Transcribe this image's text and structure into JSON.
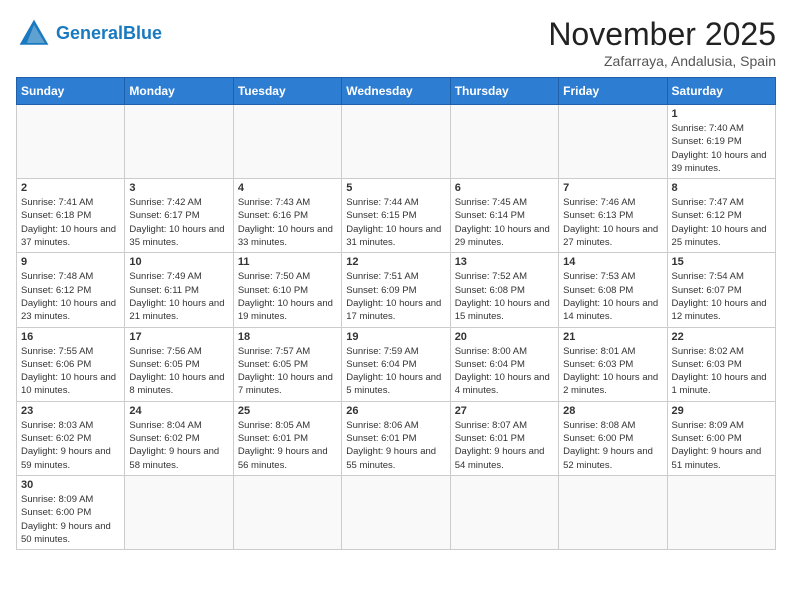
{
  "header": {
    "logo_general": "General",
    "logo_blue": "Blue",
    "month_title": "November 2025",
    "location": "Zafarraya, Andalusia, Spain"
  },
  "weekdays": [
    "Sunday",
    "Monday",
    "Tuesday",
    "Wednesday",
    "Thursday",
    "Friday",
    "Saturday"
  ],
  "days": [
    {
      "date": "",
      "info": ""
    },
    {
      "date": "",
      "info": ""
    },
    {
      "date": "",
      "info": ""
    },
    {
      "date": "",
      "info": ""
    },
    {
      "date": "",
      "info": ""
    },
    {
      "date": "",
      "info": ""
    },
    {
      "date": "1",
      "info": "Sunrise: 7:40 AM\nSunset: 6:19 PM\nDaylight: 10 hours\nand 39 minutes."
    },
    {
      "date": "2",
      "info": "Sunrise: 7:41 AM\nSunset: 6:18 PM\nDaylight: 10 hours\nand 37 minutes."
    },
    {
      "date": "3",
      "info": "Sunrise: 7:42 AM\nSunset: 6:17 PM\nDaylight: 10 hours\nand 35 minutes."
    },
    {
      "date": "4",
      "info": "Sunrise: 7:43 AM\nSunset: 6:16 PM\nDaylight: 10 hours\nand 33 minutes."
    },
    {
      "date": "5",
      "info": "Sunrise: 7:44 AM\nSunset: 6:15 PM\nDaylight: 10 hours\nand 31 minutes."
    },
    {
      "date": "6",
      "info": "Sunrise: 7:45 AM\nSunset: 6:14 PM\nDaylight: 10 hours\nand 29 minutes."
    },
    {
      "date": "7",
      "info": "Sunrise: 7:46 AM\nSunset: 6:13 PM\nDaylight: 10 hours\nand 27 minutes."
    },
    {
      "date": "8",
      "info": "Sunrise: 7:47 AM\nSunset: 6:12 PM\nDaylight: 10 hours\nand 25 minutes."
    },
    {
      "date": "9",
      "info": "Sunrise: 7:48 AM\nSunset: 6:12 PM\nDaylight: 10 hours\nand 23 minutes."
    },
    {
      "date": "10",
      "info": "Sunrise: 7:49 AM\nSunset: 6:11 PM\nDaylight: 10 hours\nand 21 minutes."
    },
    {
      "date": "11",
      "info": "Sunrise: 7:50 AM\nSunset: 6:10 PM\nDaylight: 10 hours\nand 19 minutes."
    },
    {
      "date": "12",
      "info": "Sunrise: 7:51 AM\nSunset: 6:09 PM\nDaylight: 10 hours\nand 17 minutes."
    },
    {
      "date": "13",
      "info": "Sunrise: 7:52 AM\nSunset: 6:08 PM\nDaylight: 10 hours\nand 15 minutes."
    },
    {
      "date": "14",
      "info": "Sunrise: 7:53 AM\nSunset: 6:08 PM\nDaylight: 10 hours\nand 14 minutes."
    },
    {
      "date": "15",
      "info": "Sunrise: 7:54 AM\nSunset: 6:07 PM\nDaylight: 10 hours\nand 12 minutes."
    },
    {
      "date": "16",
      "info": "Sunrise: 7:55 AM\nSunset: 6:06 PM\nDaylight: 10 hours\nand 10 minutes."
    },
    {
      "date": "17",
      "info": "Sunrise: 7:56 AM\nSunset: 6:05 PM\nDaylight: 10 hours\nand 8 minutes."
    },
    {
      "date": "18",
      "info": "Sunrise: 7:57 AM\nSunset: 6:05 PM\nDaylight: 10 hours\nand 7 minutes."
    },
    {
      "date": "19",
      "info": "Sunrise: 7:59 AM\nSunset: 6:04 PM\nDaylight: 10 hours\nand 5 minutes."
    },
    {
      "date": "20",
      "info": "Sunrise: 8:00 AM\nSunset: 6:04 PM\nDaylight: 10 hours\nand 4 minutes."
    },
    {
      "date": "21",
      "info": "Sunrise: 8:01 AM\nSunset: 6:03 PM\nDaylight: 10 hours\nand 2 minutes."
    },
    {
      "date": "22",
      "info": "Sunrise: 8:02 AM\nSunset: 6:03 PM\nDaylight: 10 hours\nand 1 minute."
    },
    {
      "date": "23",
      "info": "Sunrise: 8:03 AM\nSunset: 6:02 PM\nDaylight: 9 hours\nand 59 minutes."
    },
    {
      "date": "24",
      "info": "Sunrise: 8:04 AM\nSunset: 6:02 PM\nDaylight: 9 hours\nand 58 minutes."
    },
    {
      "date": "25",
      "info": "Sunrise: 8:05 AM\nSunset: 6:01 PM\nDaylight: 9 hours\nand 56 minutes."
    },
    {
      "date": "26",
      "info": "Sunrise: 8:06 AM\nSunset: 6:01 PM\nDaylight: 9 hours\nand 55 minutes."
    },
    {
      "date": "27",
      "info": "Sunrise: 8:07 AM\nSunset: 6:01 PM\nDaylight: 9 hours\nand 54 minutes."
    },
    {
      "date": "28",
      "info": "Sunrise: 8:08 AM\nSunset: 6:00 PM\nDaylight: 9 hours\nand 52 minutes."
    },
    {
      "date": "29",
      "info": "Sunrise: 8:09 AM\nSunset: 6:00 PM\nDaylight: 9 hours\nand 51 minutes."
    },
    {
      "date": "30",
      "info": "Sunrise: 8:09 AM\nSunset: 6:00 PM\nDaylight: 9 hours\nand 50 minutes."
    }
  ]
}
